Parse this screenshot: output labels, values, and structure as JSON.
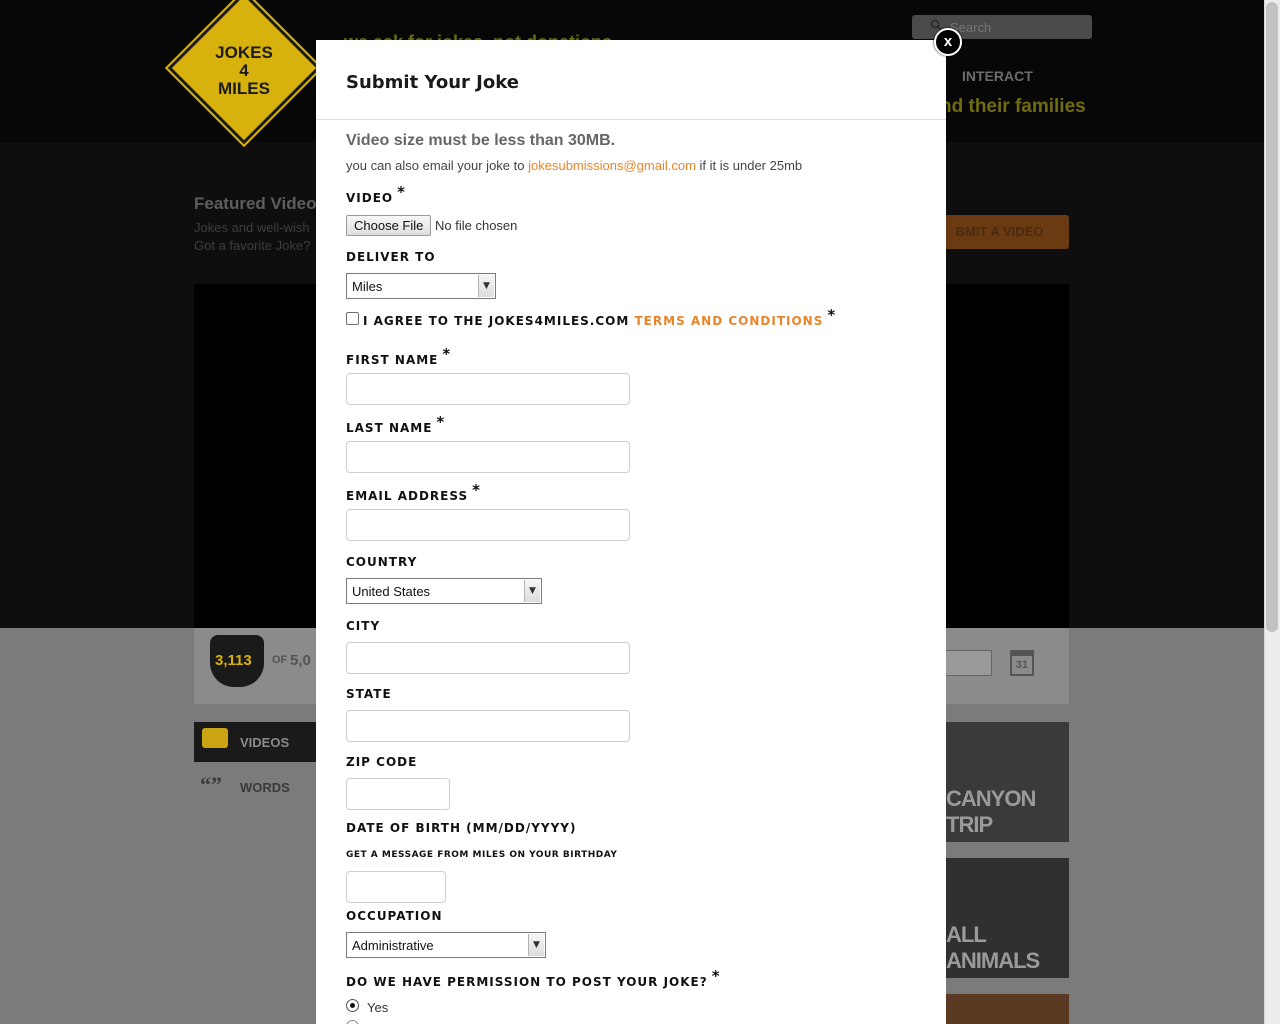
{
  "background": {
    "logo": {
      "line1": "JOKES",
      "line2": "4",
      "line3": "MILES"
    },
    "tagline": "we ask for jokes, not donations",
    "nav": {
      "interact": "INTERACT",
      "families": "nd their families"
    },
    "search": {
      "placeholder": "Search"
    },
    "featured": {
      "title": "Featured Video",
      "desc_line1": "Jokes and well-wish",
      "desc_line2": "Got a favorite Joke?"
    },
    "submit_video_label": "BMIT A VIDEO",
    "counter": {
      "count": "3,113",
      "of": "OF",
      "total": "5,0"
    },
    "calendar_day": "31",
    "tabs": {
      "videos": "VIDEOS",
      "words": "WORDS",
      "words_icon": "“”"
    },
    "thumbnails": [
      "CANYON TRIP",
      "ALL ANIMALS",
      ""
    ]
  },
  "modal": {
    "title": "Submit Your Joke",
    "close_label": "x",
    "size_note": "Video size must be less than 30MB.",
    "email_note_prefix": "you can also email your joke to ",
    "email_address": "jokesubmissions@gmail.com",
    "email_note_suffix": " if it is under 25mb",
    "video": {
      "label": "VIDEO",
      "required": "*",
      "button": "Choose File",
      "status": "No file chosen"
    },
    "deliver_to": {
      "label": "DELIVER TO",
      "value": "Miles"
    },
    "terms": {
      "prefix": "I AGREE TO THE JOKES4MILES.COM ",
      "link": "TERMS AND CONDITIONS",
      "required": "*"
    },
    "first_name": {
      "label": "FIRST NAME",
      "required": "*",
      "value": ""
    },
    "last_name": {
      "label": "LAST NAME",
      "required": "*",
      "value": ""
    },
    "email": {
      "label": "EMAIL ADDRESS",
      "required": "*",
      "value": ""
    },
    "country": {
      "label": "COUNTRY",
      "value": "United States"
    },
    "city": {
      "label": "CITY",
      "value": ""
    },
    "state": {
      "label": "STATE",
      "value": ""
    },
    "zip": {
      "label": "ZIP CODE",
      "value": ""
    },
    "dob": {
      "label": "DATE OF BIRTH (MM/DD/YYYY)",
      "sublabel": "GET A MESSAGE FROM MILES ON YOUR BIRTHDAY",
      "value": ""
    },
    "occupation": {
      "label": "OCCUPATION",
      "value": "Administrative"
    },
    "permission": {
      "label": "DO WE HAVE PERMISSION TO POST YOUR JOKE?",
      "required": "*",
      "option_yes": "Yes"
    }
  },
  "colors": {
    "accent": "#e8852c",
    "logo_yellow": "#d8b20c"
  }
}
